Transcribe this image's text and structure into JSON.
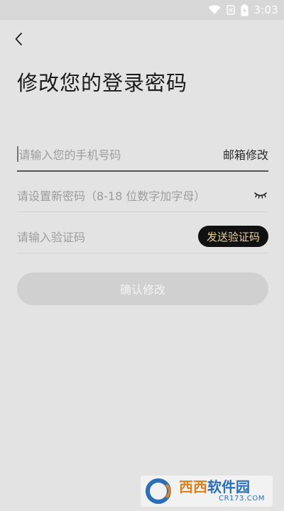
{
  "status_bar": {
    "time": "3:03",
    "icons": [
      "wifi-icon",
      "notification-icon",
      "battery-icon"
    ]
  },
  "header": {
    "back_icon": "chevron-left-icon",
    "title": "修改您的登录密码"
  },
  "form": {
    "phone": {
      "placeholder": "请输入您的手机号码",
      "alt_link": "邮箱修改"
    },
    "password": {
      "placeholder": "请设置新密码（8-18 位数字加字母）",
      "toggle_icon": "eye-closed-icon"
    },
    "code": {
      "placeholder": "请输入验证码",
      "send_button": "发送验证码"
    },
    "submit": "确认修改"
  },
  "watermark": {
    "main_accent": "西西",
    "main_rest": "软件园",
    "sub": "CR173.COM"
  },
  "colors": {
    "background": "#e3e3e3",
    "send_button_bg": "#111111",
    "send_button_text": "#e8cf98",
    "submit_bg": "#d0d0d0"
  }
}
